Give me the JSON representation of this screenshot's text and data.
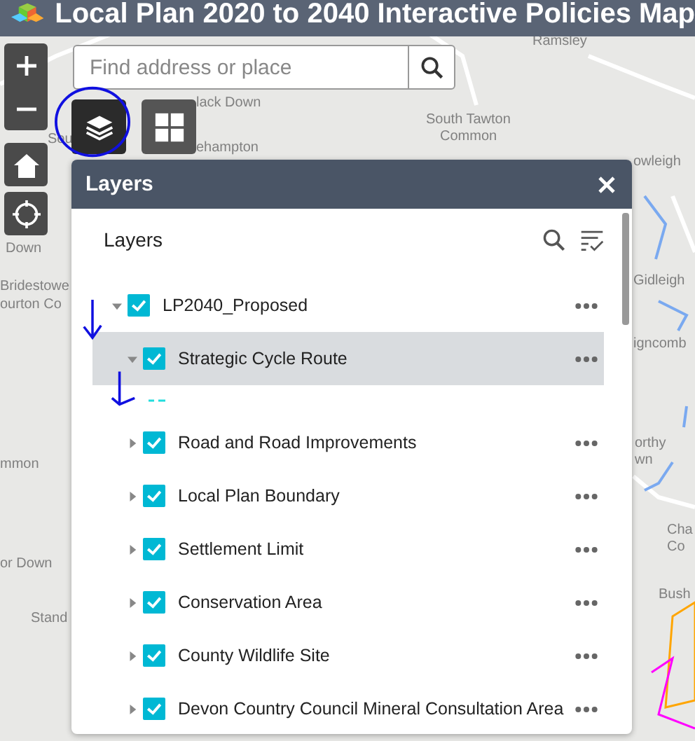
{
  "header": {
    "title": "Local Plan 2020 to 2040 Interactive Policies Map"
  },
  "search": {
    "placeholder": "Find address or place"
  },
  "map_labels": [
    "Ramsley",
    "lack Down",
    "South Tawton",
    "Common",
    "Sou",
    "ehampton",
    "owleigh",
    "Down",
    "Gidleigh",
    "Bridestowe",
    "ourton Co",
    "igncomb",
    "orthy",
    "mmon",
    "wn",
    "Cha",
    "Co",
    "or Down",
    "Bush",
    "Stand"
  ],
  "panel": {
    "title": "Layers",
    "list_title": "Layers",
    "layers": [
      {
        "name": "LP2040_Proposed",
        "checked": true,
        "expanded": true,
        "selected": false,
        "children": [
          {
            "name": "Strategic Cycle Route",
            "checked": true,
            "expanded": true,
            "selected": true
          },
          {
            "name": "Road and Road Improvements",
            "checked": true,
            "expanded": false,
            "selected": false
          },
          {
            "name": "Local Plan Boundary",
            "checked": true,
            "expanded": false,
            "selected": false
          },
          {
            "name": "Settlement Limit",
            "checked": true,
            "expanded": false,
            "selected": false
          },
          {
            "name": "Conservation Area",
            "checked": true,
            "expanded": false,
            "selected": false
          },
          {
            "name": "County Wildlife Site",
            "checked": true,
            "expanded": false,
            "selected": false
          },
          {
            "name": "Devon Country Council Mineral Consultation Area",
            "checked": true,
            "expanded": false,
            "selected": false
          }
        ]
      }
    ]
  }
}
